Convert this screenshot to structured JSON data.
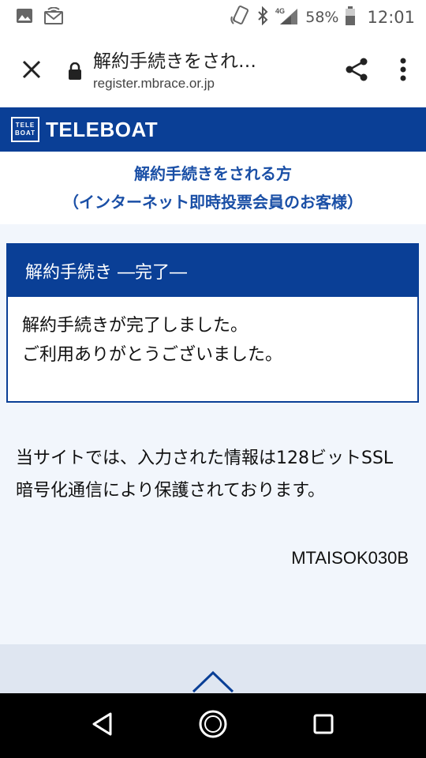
{
  "status_bar": {
    "icons_left": [
      "image-icon",
      "cast-icon"
    ],
    "icons_right": [
      "nfc-icon",
      "bluetooth-icon",
      "signal-4g-icon",
      "battery-icon"
    ],
    "battery_percent": "58%",
    "time": "12:01"
  },
  "browser": {
    "page_title": "解約手続きをされ…",
    "url": "register.mbrace.or.jp"
  },
  "header": {
    "logo_mark_top": "TELE",
    "logo_mark_bottom": "BOAT",
    "logo_text": "TELEBOAT",
    "brand_color": "#0a3f96"
  },
  "subtitle": {
    "line1": "解約手続きをされる方",
    "line2": "（インターネット即時投票会員のお客様）"
  },
  "panel": {
    "title": "解約手続き ―完了―",
    "line1": "解約手続きが完了しました。",
    "line2": "ご利用ありがとうございました。"
  },
  "note": {
    "text": "当サイトでは、入力された情報は128ビットSSL暗号化通信により保護されております。"
  },
  "screen_code": "MTAISOK030B"
}
